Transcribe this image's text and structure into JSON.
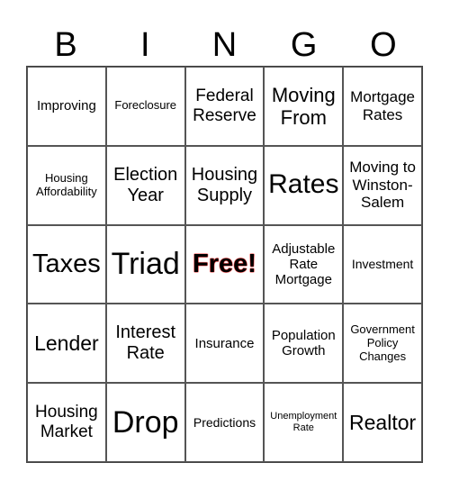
{
  "header": [
    "B",
    "I",
    "N",
    "G",
    "O"
  ],
  "cells": [
    [
      "Improving",
      "Foreclosure",
      "Federal Reserve",
      "Moving From",
      "Mortgage Rates"
    ],
    [
      "Housing Affordability",
      "Election Year",
      "Housing Supply",
      "Rates",
      "Moving to Winston-Salem"
    ],
    [
      "Taxes",
      "Triad",
      "Free!",
      "Adjustable Rate Mortgage",
      "Investment"
    ],
    [
      "Lender",
      "Interest Rate",
      "Insurance",
      "Population Growth",
      "Government Policy Changes"
    ],
    [
      "Housing Market",
      "Drop",
      "Predictions",
      "Unemployment Rate",
      "Realtor"
    ]
  ],
  "colors": {
    "free_outline": "#e00000",
    "grid": "#555555"
  }
}
